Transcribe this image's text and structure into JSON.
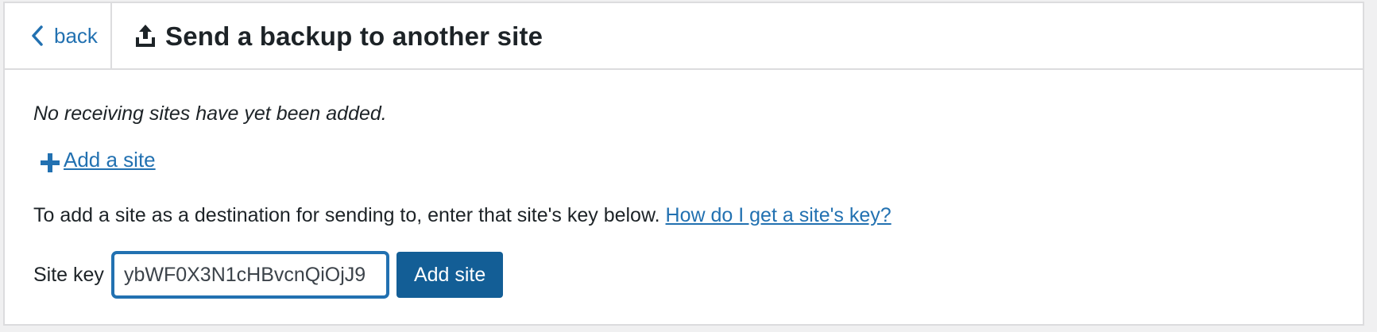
{
  "header": {
    "back_label": "back",
    "title": "Send a backup to another site",
    "back_icon": "chevron-left-icon",
    "title_icon": "upload-icon"
  },
  "body": {
    "empty_note": "No receiving sites have yet been added.",
    "add_site_link": "Add a site",
    "add_site_icon": "plus-icon",
    "instruction_text": "To add a site as a destination for sending to, enter that site's key below.",
    "help_link": "How do I get a site's key?",
    "site_key_label": "Site key",
    "site_key_value": "ybWF0X3N1cHBvcnQiOjJ9",
    "add_site_button": "Add site"
  },
  "colors": {
    "accent": "#2271b1",
    "button_bg": "#135e96",
    "text": "#1d2327",
    "border": "#dcdcde",
    "page_bg": "#f0f0f1"
  }
}
